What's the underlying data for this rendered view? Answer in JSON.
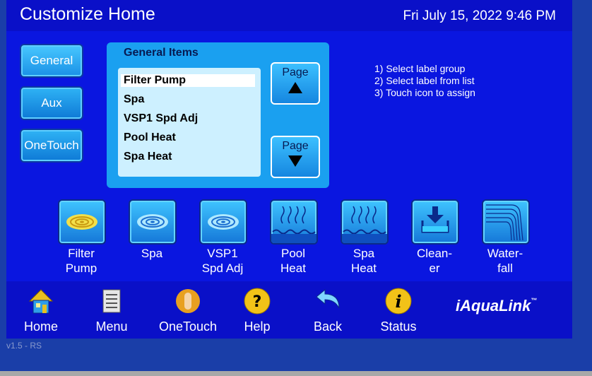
{
  "header": {
    "title": "Customize Home",
    "datetime": "Fri July 15, 2022 9:46 PM"
  },
  "label_groups": [
    {
      "label": "General",
      "active": true
    },
    {
      "label": "Aux",
      "active": false
    },
    {
      "label": "OneTouch",
      "active": false
    }
  ],
  "items_panel": {
    "title": "General Items",
    "items": [
      "Filter Pump",
      "Spa",
      "VSP1 Spd Adj",
      "Pool Heat",
      "Spa Heat"
    ],
    "selected": "Filter Pump",
    "page_up_label": "Page",
    "page_down_label": "Page"
  },
  "instructions": [
    "1) Select label group",
    "2) Select label from list",
    "3) Touch icon to assign"
  ],
  "devices": [
    {
      "icon": "swirl-icon",
      "line1": "Filter",
      "line2": "Pump"
    },
    {
      "icon": "swirl-icon",
      "line1": "Spa",
      "line2": ""
    },
    {
      "icon": "swirl-icon",
      "line1": "VSP1",
      "line2": "Spd Adj"
    },
    {
      "icon": "heat-waves-icon",
      "line1": "Pool",
      "line2": "Heat"
    },
    {
      "icon": "heat-waves-icon",
      "line1": "Spa",
      "line2": "Heat"
    },
    {
      "icon": "cleaner-icon",
      "line1": "Clean-",
      "line2": "er"
    },
    {
      "icon": "waterfall-icon",
      "line1": "Water-",
      "line2": "fall"
    }
  ],
  "nav": [
    {
      "icon": "home-icon",
      "label": "Home"
    },
    {
      "icon": "menu-icon",
      "label": "Menu"
    },
    {
      "icon": "onetouch-icon",
      "label": "OneTouch"
    },
    {
      "icon": "help-icon",
      "label": "Help"
    },
    {
      "icon": "back-icon",
      "label": "Back"
    },
    {
      "icon": "info-icon",
      "label": "Status"
    }
  ],
  "logo": {
    "text": "iAquaLink",
    "tm": "™"
  },
  "version": "v1.5 - RS"
}
